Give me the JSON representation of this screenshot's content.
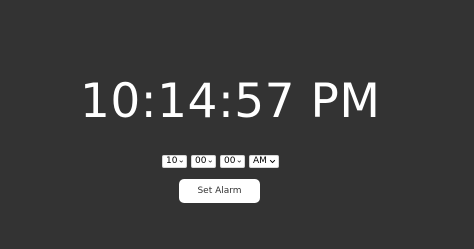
{
  "clock": {
    "time_display": "10:14:57 PM"
  },
  "alarm": {
    "hour": {
      "selected": "10",
      "icon": "chevron-down-icon"
    },
    "minute": {
      "selected": "00",
      "icon": "chevron-down-icon"
    },
    "second": {
      "selected": "00",
      "icon": "chevron-down-icon"
    },
    "ampm": {
      "selected": "AM",
      "icon": "chevron-down-icon"
    },
    "set_button_label": "Set Alarm"
  },
  "colors": {
    "background": "#333333",
    "text": "#ffffff",
    "button_bg": "#ffffff",
    "button_text": "#333333"
  }
}
